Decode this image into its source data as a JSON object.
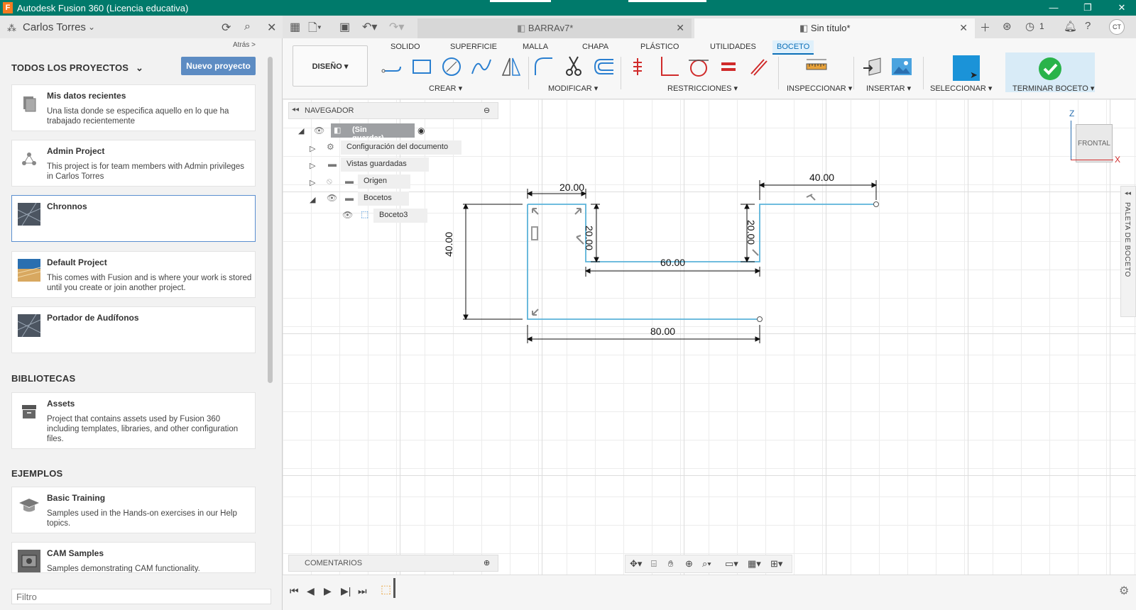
{
  "window": {
    "title": "Autodesk Fusion 360 (Licencia educativa)",
    "app_letter": "F"
  },
  "left_panel": {
    "user": "Carlos Torres",
    "back": "Atrás >",
    "all_projects": "TODOS LOS PROYECTOS",
    "new_project": "Nuevo proyecto",
    "projects": [
      {
        "name": "Mis datos recientes",
        "desc": "Una lista donde se especifica aquello en lo que ha trabajado recientemente"
      },
      {
        "name": "Admin Project",
        "desc": "This project is for team members with Admin privileges in Carlos Torres"
      },
      {
        "name": "Chronnos",
        "desc": ""
      },
      {
        "name": "Default Project",
        "desc": "This comes with Fusion and is where your work is stored until you create or join another project."
      },
      {
        "name": "Portador de Audífonos",
        "desc": ""
      }
    ],
    "libraries_title": "BIBLIOTECAS",
    "libraries": [
      {
        "name": "Assets",
        "desc": "Project that contains assets used by Fusion 360 including templates, libraries, and other configuration files."
      }
    ],
    "examples_title": "EJEMPLOS",
    "examples": [
      {
        "name": "Basic Training",
        "desc": "Samples used in the Hands-on exercises in our Help topics."
      },
      {
        "name": "CAM Samples",
        "desc": "Samples demonstrating CAM functionality."
      }
    ],
    "filter_placeholder": "Filtro"
  },
  "tabs": [
    {
      "label": "BARRAv7*"
    },
    {
      "label": "Sin título*"
    }
  ],
  "notifications_count": "1",
  "avatar": "CT",
  "ribbon": {
    "design": "DISEÑO",
    "tabs": [
      "SOLIDO",
      "SUPERFICIE",
      "MALLA",
      "CHAPA",
      "PLÁSTICO",
      "UTILIDADES",
      "BOCETO"
    ],
    "active_tab": "BOCETO",
    "groups": {
      "create": "CREAR",
      "modify": "MODIFICAR",
      "constraints": "RESTRICCIONES",
      "inspect": "INSPECCIONAR",
      "insert": "INSERTAR",
      "select": "SELECCIONAR",
      "finish": "TERMINAR BOCETO"
    }
  },
  "browser": {
    "title": "NAVEGADOR",
    "items": [
      {
        "label": "(Sin guardar)"
      },
      {
        "label": "Configuración del documento"
      },
      {
        "label": "Vistas guardadas"
      },
      {
        "label": "Origen"
      },
      {
        "label": "Bocetos"
      },
      {
        "label": "Boceto3"
      }
    ]
  },
  "comments": "COMENTARIOS",
  "viewcube": {
    "face": "FRONTAL",
    "axis_z": "Z",
    "axis_x": "X"
  },
  "sketch_palette": "PALETA DE BOCETO",
  "dimensions": [
    "20.00",
    "40.00",
    "20.00",
    "20.00",
    "60.00",
    "40.00",
    "80.00"
  ],
  "colors": {
    "titlebar": "#007a6b",
    "accent": "#0b6fb8",
    "sketch_line": "#5bb3d9",
    "select_button": "#1b93d8"
  }
}
